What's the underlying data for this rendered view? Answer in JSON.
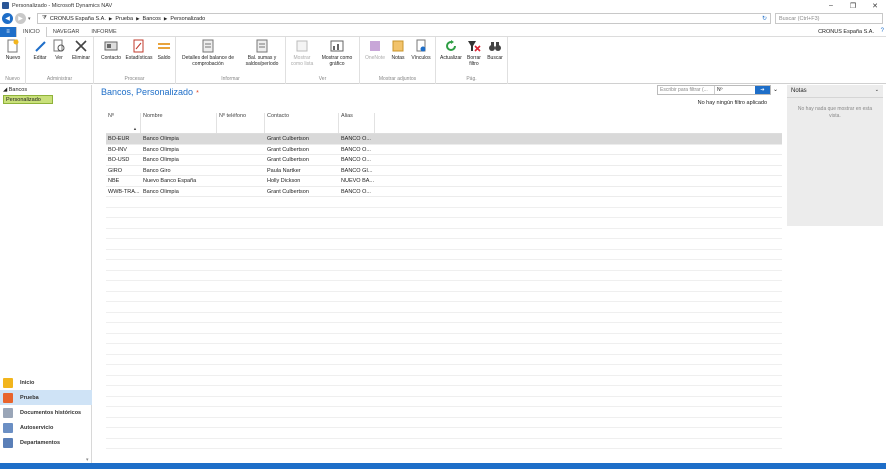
{
  "window": {
    "title": "Personalizado - Microsoft Dynamics NAV"
  },
  "address": {
    "crumbs": [
      "CRONUS España S.A.",
      "Prueba",
      "Bancos",
      "Personalizado"
    ],
    "search_placeholder": "Buscar (Ctrl+F3)"
  },
  "tabs": {
    "file": "≡",
    "items": [
      "INICIO",
      "NAVEGAR",
      "INFORME"
    ],
    "company": "CRONUS España S.A."
  },
  "ribbon": {
    "groups": [
      {
        "label": "Nuevo",
        "buttons": [
          "Nuevo"
        ]
      },
      {
        "label": "Administrar",
        "buttons": [
          "Editar",
          "Ver",
          "Eliminar"
        ]
      },
      {
        "label": "Procesar",
        "buttons": [
          "Contacto",
          "Estadísticas",
          "Saldo"
        ]
      },
      {
        "label": "Informar",
        "buttons": [
          "Detalles del balance de comprobación",
          "Bal. sumas y saldos/período"
        ]
      },
      {
        "label": "Ver",
        "buttons": [
          "Mostrar como lista",
          "Mostrar como gráfico"
        ]
      },
      {
        "label": "Mostrar adjuntos",
        "buttons": [
          "OneNote",
          "Notas",
          "Vínculos"
        ]
      },
      {
        "label": "Pág.",
        "buttons": [
          "Actualizar",
          "Borrar filtro",
          "Buscar"
        ]
      }
    ]
  },
  "leftnav": {
    "tree_root": "Bancos",
    "tree_selected": "Personalizado",
    "items": [
      "Inicio",
      "Prueba",
      "Documentos históricos",
      "Autoservicio",
      "Departamentos"
    ]
  },
  "page": {
    "title": "Bancos, Personalizado",
    "star": "*",
    "filter_placeholder": "Escribir para filtrar (...",
    "filter_field": "Nº",
    "no_filter": "No hay ningún filtro aplicado"
  },
  "grid": {
    "columns": [
      "Nº",
      "Nombre",
      "Nº teléfono",
      "Contacto",
      "Alias"
    ],
    "rows": [
      [
        "BO-EUR",
        "Banco Olimpia",
        "",
        "Grant Culbertson",
        "BANCO O..."
      ],
      [
        "BO-INV",
        "Banco Olimpia",
        "",
        "Grant Culbertson",
        "BANCO O..."
      ],
      [
        "BO-USD",
        "Banco Olimpia",
        "",
        "Grant Culbertson",
        "BANCO O..."
      ],
      [
        "GIRO",
        "Banco Giro",
        "",
        "Paula Nartker",
        "BANCO GI..."
      ],
      [
        "NBE",
        "Nuevo Banco España",
        "",
        "Holly Dickson",
        "NUEVO BA..."
      ],
      [
        "WWB-TRA...",
        "Banco Olimpia",
        "",
        "Grant Culbertson",
        "BANCO O..."
      ]
    ]
  },
  "notes": {
    "title": "Notas",
    "empty": "No hay nada que mostrar en esta vista."
  },
  "colors": {
    "accent": "#1e6ec8",
    "selection": "#c9e07a",
    "nav_active": "#cfe3f6"
  }
}
